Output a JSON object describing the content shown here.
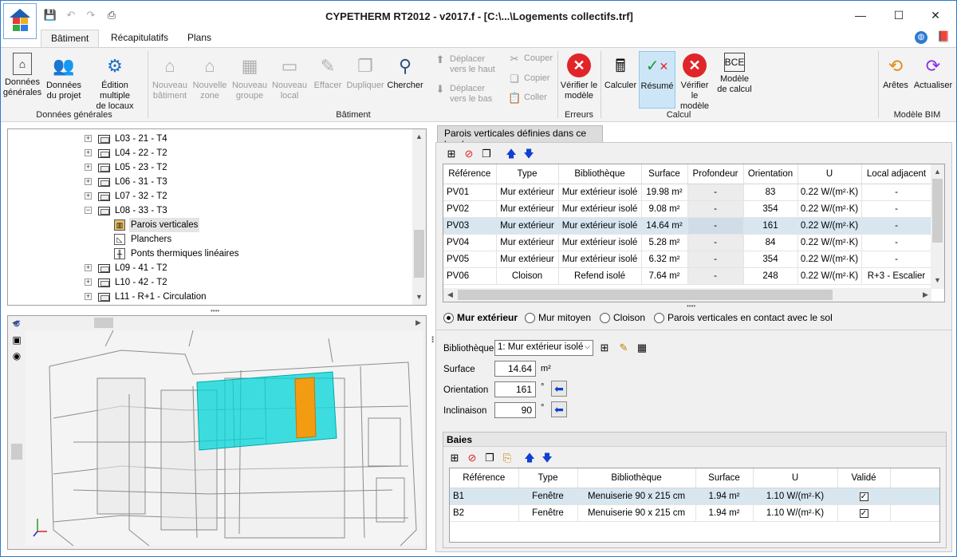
{
  "window": {
    "title": "CYPETHERM RT2012 - v2017.f - [C:\\...\\Logements collectifs.trf]",
    "minimize": "—",
    "maximize": "☐",
    "close": "✕"
  },
  "tabs": [
    {
      "label": "Bâtiment"
    },
    {
      "label": "Récapitulatifs"
    },
    {
      "label": "Plans"
    }
  ],
  "ribbon": {
    "groups": [
      {
        "label": "Données générales"
      },
      {
        "label": "Bâtiment"
      },
      {
        "label": "Erreurs"
      },
      {
        "label": "Calcul"
      },
      {
        "label": "Modèle BIM"
      }
    ],
    "donnees_generales": "Données\ngénérales",
    "donnees_projet": "Données\ndu projet",
    "edition_multiple": "Édition multiple\nde locaux",
    "nouveau_batiment": "Nouveau\nbâtiment",
    "nouvelle_zone": "Nouvelle\nzone",
    "nouveau_groupe": "Nouveau\ngroupe",
    "nouveau_local": "Nouveau\nlocal",
    "effacer": "Effacer",
    "dupliquer": "Dupliquer",
    "chercher": "Chercher",
    "deplacer_haut": "Déplacer\nvers le haut",
    "deplacer_bas": "Déplacer\nvers le bas",
    "couper": "Couper",
    "copier": "Copier",
    "coller": "Coller",
    "verifier_modele": "Vérifier le\nmodèle",
    "calculer": "Calculer",
    "resume": "Résumé",
    "verifier_modele2": "Vérifier le\nmodèle",
    "modele_calcul": "Modèle\nde calcul",
    "aretes": "Arêtes",
    "actualiser": "Actualiser"
  },
  "tree": {
    "items": [
      {
        "label": "L03 - 21 - T4",
        "kind": "local",
        "expanded": false
      },
      {
        "label": "L04 - 22 - T2",
        "kind": "local",
        "expanded": false
      },
      {
        "label": "L05 - 23 - T2",
        "kind": "local",
        "expanded": false
      },
      {
        "label": "L06 - 31 - T3",
        "kind": "local",
        "expanded": false
      },
      {
        "label": "L07 - 32 - T2",
        "kind": "local",
        "expanded": false
      },
      {
        "label": "L08 - 33 - T3",
        "kind": "local",
        "expanded": true
      },
      {
        "label": "Parois verticales",
        "kind": "child",
        "selected": true
      },
      {
        "label": "Planchers",
        "kind": "child"
      },
      {
        "label": "Ponts thermiques linéaires",
        "kind": "child"
      },
      {
        "label": "L09 - 41 - T2",
        "kind": "local",
        "expanded": false
      },
      {
        "label": "L10 - 42 - T2",
        "kind": "local",
        "expanded": false
      },
      {
        "label": "L11 - R+1 - Circulation",
        "kind": "local",
        "expanded": false
      }
    ]
  },
  "right_panel": {
    "tab_label": "Parois verticales définies dans ce local",
    "columns": [
      "Référence",
      "Type",
      "Bibliothèque",
      "Surface",
      "Profondeur",
      "Orientation",
      "U",
      "Local adjacent"
    ],
    "rows": [
      [
        "PV01",
        "Mur extérieur",
        "Mur extérieur isolé",
        "19.98 m²",
        "-",
        "83",
        "0.22 W/(m²·K)",
        "-"
      ],
      [
        "PV02",
        "Mur extérieur",
        "Mur extérieur isolé",
        "9.08 m²",
        "-",
        "354",
        "0.22 W/(m²·K)",
        "-"
      ],
      [
        "PV03",
        "Mur extérieur",
        "Mur extérieur isolé",
        "14.64 m²",
        "-",
        "161",
        "0.22 W/(m²·K)",
        "-"
      ],
      [
        "PV04",
        "Mur extérieur",
        "Mur extérieur isolé",
        "5.28 m²",
        "-",
        "84",
        "0.22 W/(m²·K)",
        "-"
      ],
      [
        "PV05",
        "Mur extérieur",
        "Mur extérieur isolé",
        "6.32 m²",
        "-",
        "354",
        "0.22 W/(m²·K)",
        "-"
      ],
      [
        "PV06",
        "Cloison",
        "Refend isolé",
        "7.64 m²",
        "-",
        "248",
        "0.22 W/(m²·K)",
        "R+3 - Escalier"
      ]
    ],
    "selected_row": 2,
    "radios": [
      {
        "label": "Mur extérieur",
        "checked": true
      },
      {
        "label": "Mur mitoyen",
        "checked": false
      },
      {
        "label": "Cloison",
        "checked": false
      },
      {
        "label": "Parois verticales en contact avec le sol",
        "checked": false
      }
    ],
    "bibliotheque_label": "Bibliothèque",
    "bibliotheque_value": "1: Mur extérieur isolé",
    "surface_label": "Surface",
    "surface_value": "14.64",
    "surface_unit": "m²",
    "orientation_label": "Orientation",
    "orientation_value": "161",
    "orientation_unit": "°",
    "inclinaison_label": "Inclinaison",
    "inclinaison_value": "90",
    "inclinaison_unit": "°"
  },
  "baies": {
    "title": "Baies",
    "columns": [
      "Référence",
      "Type",
      "Bibliothèque",
      "Surface",
      "U",
      "Validé"
    ],
    "rows": [
      {
        "ref": "B1",
        "type": "Fenêtre",
        "lib": "Menuiserie 90 x 215 cm",
        "surface": "1.94 m²",
        "u": "1.10 W/(m²·K)",
        "valide": true
      },
      {
        "ref": "B2",
        "type": "Fenêtre",
        "lib": "Menuiserie 90 x 215 cm",
        "surface": "1.94 m²",
        "u": "1.10 W/(m²·K)",
        "valide": true
      }
    ],
    "selected_row": 0
  },
  "colors": {
    "accent": "#2b7bd0",
    "selected_wall": "#00d5d8",
    "highlight_wall": "#f39c12",
    "error_red": "#e0252a"
  }
}
